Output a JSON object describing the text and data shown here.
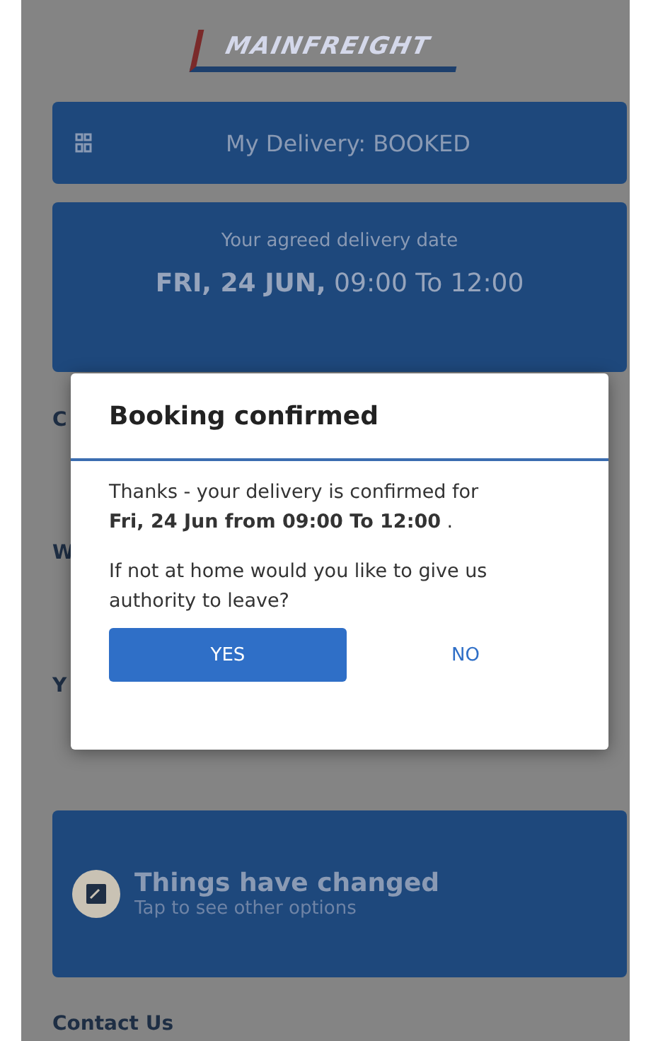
{
  "logo": "MAINFREIGHT",
  "status_card": {
    "label": "My Delivery: BOOKED"
  },
  "date_card": {
    "caption": "Your agreed delivery date",
    "date": "**FRI, 24 JUN,** 09:00 To 12:00"
  },
  "hidden_labels": [
    "C",
    "W",
    "Y"
  ],
  "change_card": {
    "title": "Things have changed",
    "subtitle": "Tap to see other options"
  },
  "footer_heading": "Contact Us",
  "dialog": {
    "title": "Booking confirmed",
    "message": "Thanks - your delivery is confirmed for **Fri, 24 Jun from 09:00 To 12:00** .",
    "question": "If not at home would you like to give us authority to leave?",
    "buttons": [
      {
        "label": "YES",
        "kind": "primary"
      },
      {
        "label": "NO",
        "kind": "text"
      }
    ]
  }
}
